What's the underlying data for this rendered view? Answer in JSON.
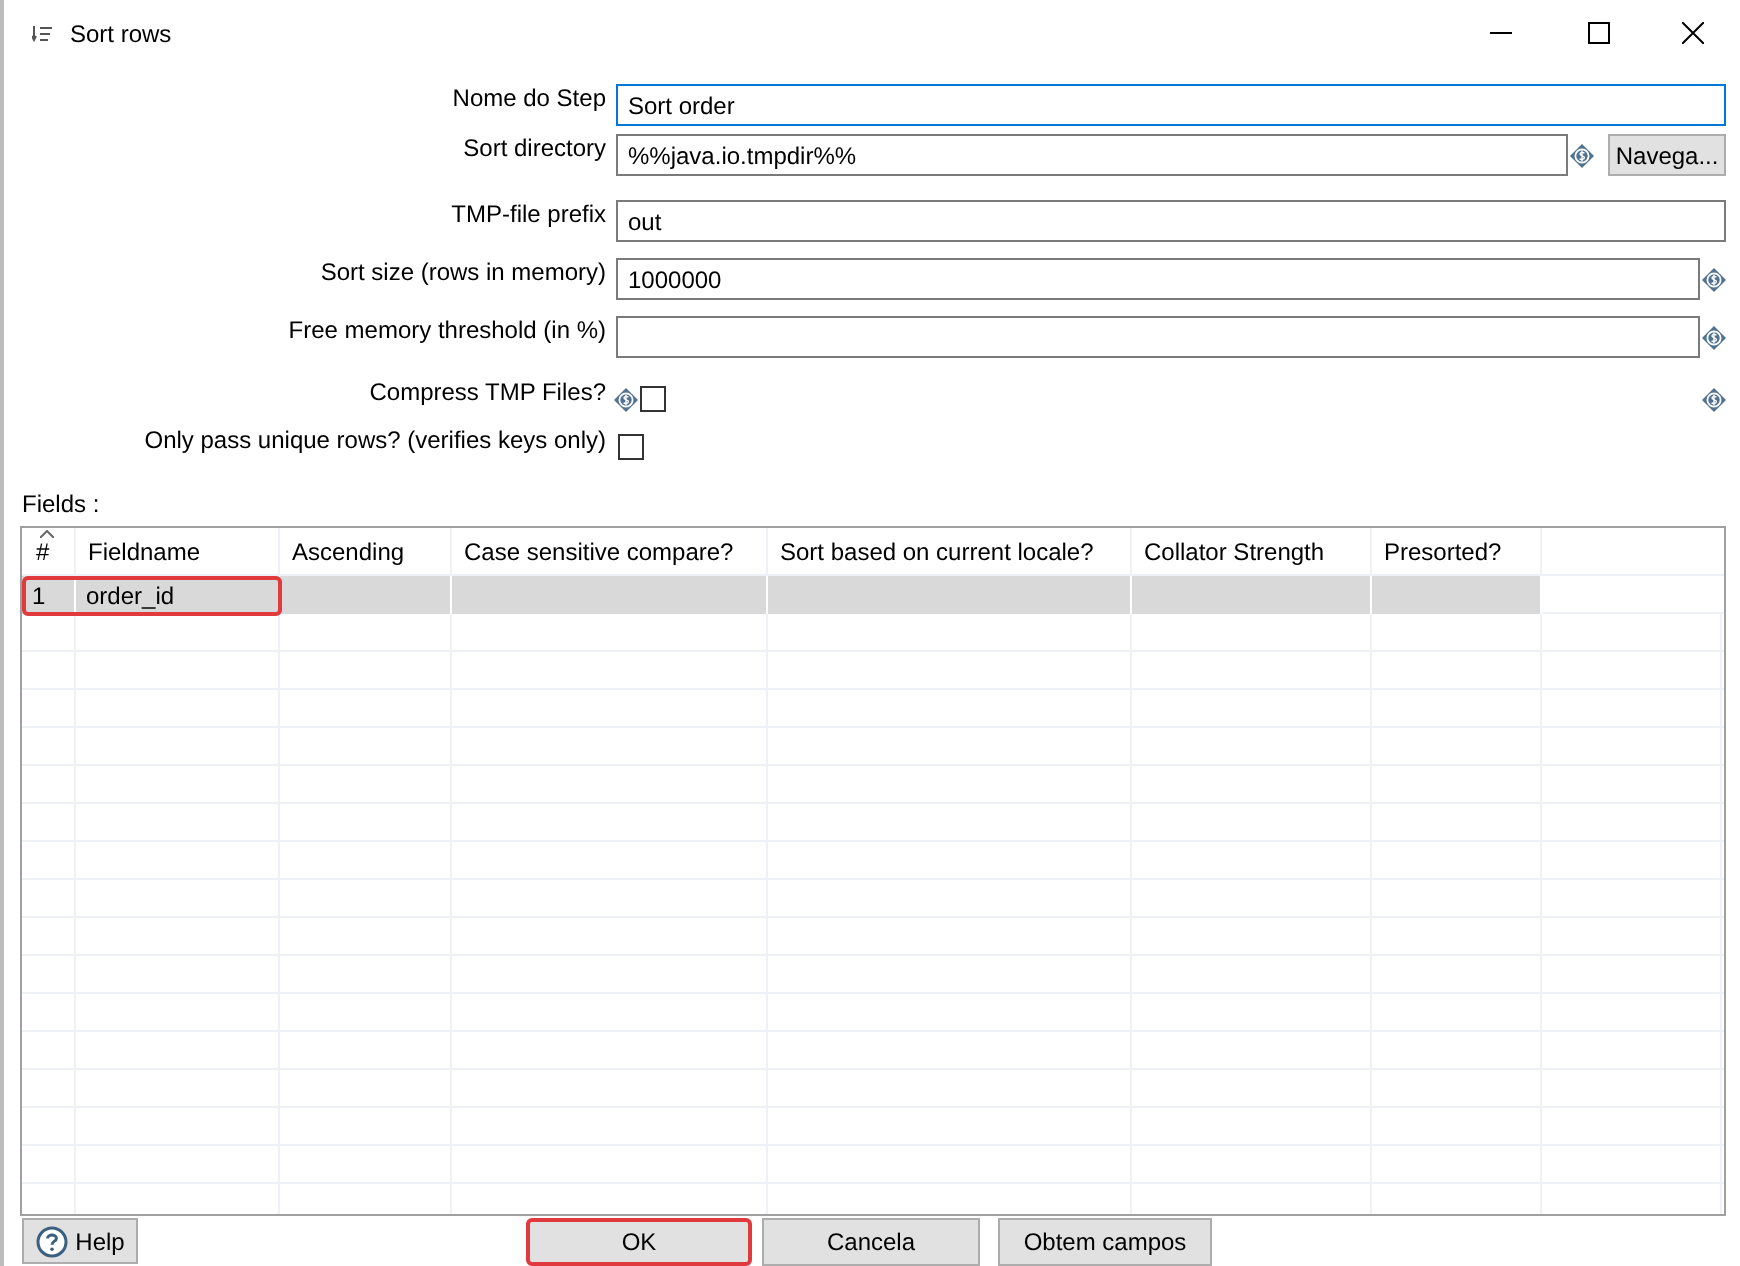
{
  "window": {
    "title": "Sort rows"
  },
  "form": [
    {
      "kind": "text",
      "label": "Nome do Step",
      "value": "Sort order",
      "focused": true,
      "variable": false
    },
    {
      "kind": "text",
      "label": "Sort directory",
      "value": "%%java.io.tmpdir%%",
      "focused": false,
      "variable": true,
      "button": "Navega..."
    },
    {
      "kind": "text",
      "label": "TMP-file prefix",
      "value": "out",
      "focused": false,
      "variable": false
    },
    {
      "kind": "text",
      "label": "Sort size (rows in memory)",
      "value": "1000000",
      "focused": false,
      "variable": true
    },
    {
      "kind": "text",
      "label": "Free memory threshold (in %)",
      "focused": false,
      "variable": true
    },
    {
      "kind": "checkbox",
      "label": "Compress TMP Files?",
      "checked": false,
      "variable": true
    },
    {
      "kind": "checkbox",
      "label": "Only pass unique rows? (verifies keys only)",
      "checked": false,
      "variable": false
    }
  ],
  "fields_label": "Fields :",
  "table": {
    "columns": [
      "#",
      "Fieldname",
      "Ascending",
      "Case sensitive compare?",
      "Sort based on current locale?",
      "Collator Strength",
      "Presorted?"
    ],
    "rows": [
      {
        "cells": [
          "1",
          "order_id",
          "",
          "",
          "",
          "",
          ""
        ],
        "highlighted": true
      }
    ]
  },
  "help_button": "Help",
  "buttons": [
    {
      "label": "OK",
      "highlighted": true
    },
    {
      "label": "Cancela",
      "highlighted": false
    },
    {
      "label": "Obtem campos",
      "highlighted": false
    }
  ]
}
